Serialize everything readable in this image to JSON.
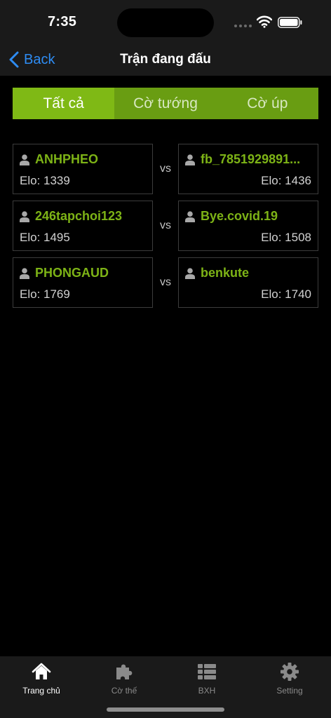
{
  "status_bar": {
    "time": "7:35"
  },
  "nav": {
    "back_label": "Back",
    "title": "Trận đang đấu"
  },
  "segments": [
    {
      "label": "Tất cả",
      "active": true
    },
    {
      "label": "Cờ tướng",
      "active": false
    },
    {
      "label": "Cờ úp",
      "active": false
    }
  ],
  "matches": [
    {
      "left": {
        "name": "ANHPHEO",
        "elo": "Elo: 1339"
      },
      "vs": "vs",
      "right": {
        "name": "fb_7851929891...",
        "elo": "Elo: 1436"
      }
    },
    {
      "left": {
        "name": "246tapchoi123",
        "elo": "Elo: 1495"
      },
      "vs": "vs",
      "right": {
        "name": "Bye.covid.19",
        "elo": "Elo: 1508"
      }
    },
    {
      "left": {
        "name": "PHONGAUD",
        "elo": "Elo: 1769"
      },
      "vs": "vs",
      "right": {
        "name": "benkute",
        "elo": "Elo: 1740"
      }
    }
  ],
  "tab_bar": [
    {
      "label": "Trang chủ",
      "icon": "home-icon",
      "active": true
    },
    {
      "label": "Cờ thế",
      "icon": "puzzle-icon",
      "active": false
    },
    {
      "label": "BXH",
      "icon": "list-icon",
      "active": false
    },
    {
      "label": "Setting",
      "icon": "gear-icon",
      "active": false
    }
  ],
  "colors": {
    "accent_green": "#7fb915",
    "segment_green": "#699d12",
    "player_name": "#7db316",
    "back_blue": "#2e8cf3"
  }
}
